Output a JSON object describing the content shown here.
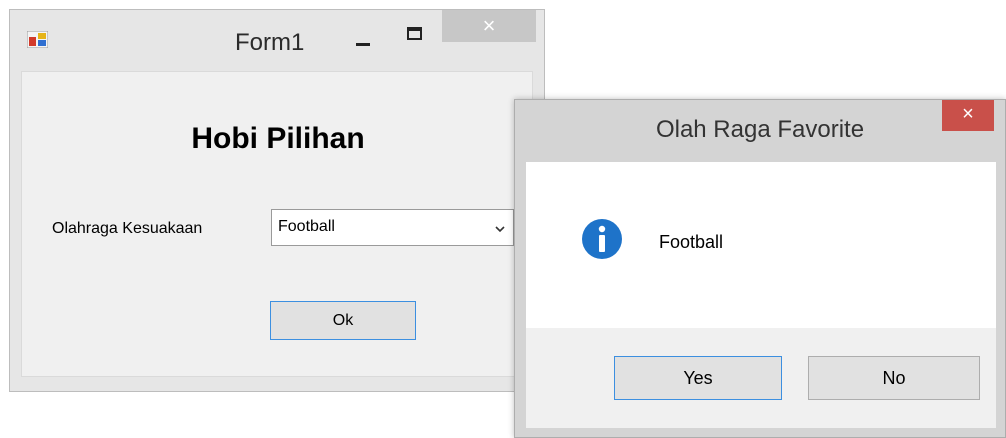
{
  "form1": {
    "title": "Form1",
    "close_glyph": "×",
    "heading": "Hobi Pilihan",
    "field_label": "Olahraga Kesuakaan",
    "combo_value": "Football",
    "ok_label": "Ok",
    "icons": {
      "app": "app-form-icon",
      "minimize": "minimize-icon",
      "maximize": "maximize-icon",
      "dropdown": "chevron-down-icon"
    }
  },
  "msgbox": {
    "title": "Olah Raga Favorite",
    "close_glyph": "×",
    "message": "Football",
    "yes_label": "Yes",
    "no_label": "No",
    "icon": "info-icon",
    "colors": {
      "info": "#1e73c9",
      "close": "#c9504a",
      "focus_border": "#3c8fe0"
    }
  }
}
